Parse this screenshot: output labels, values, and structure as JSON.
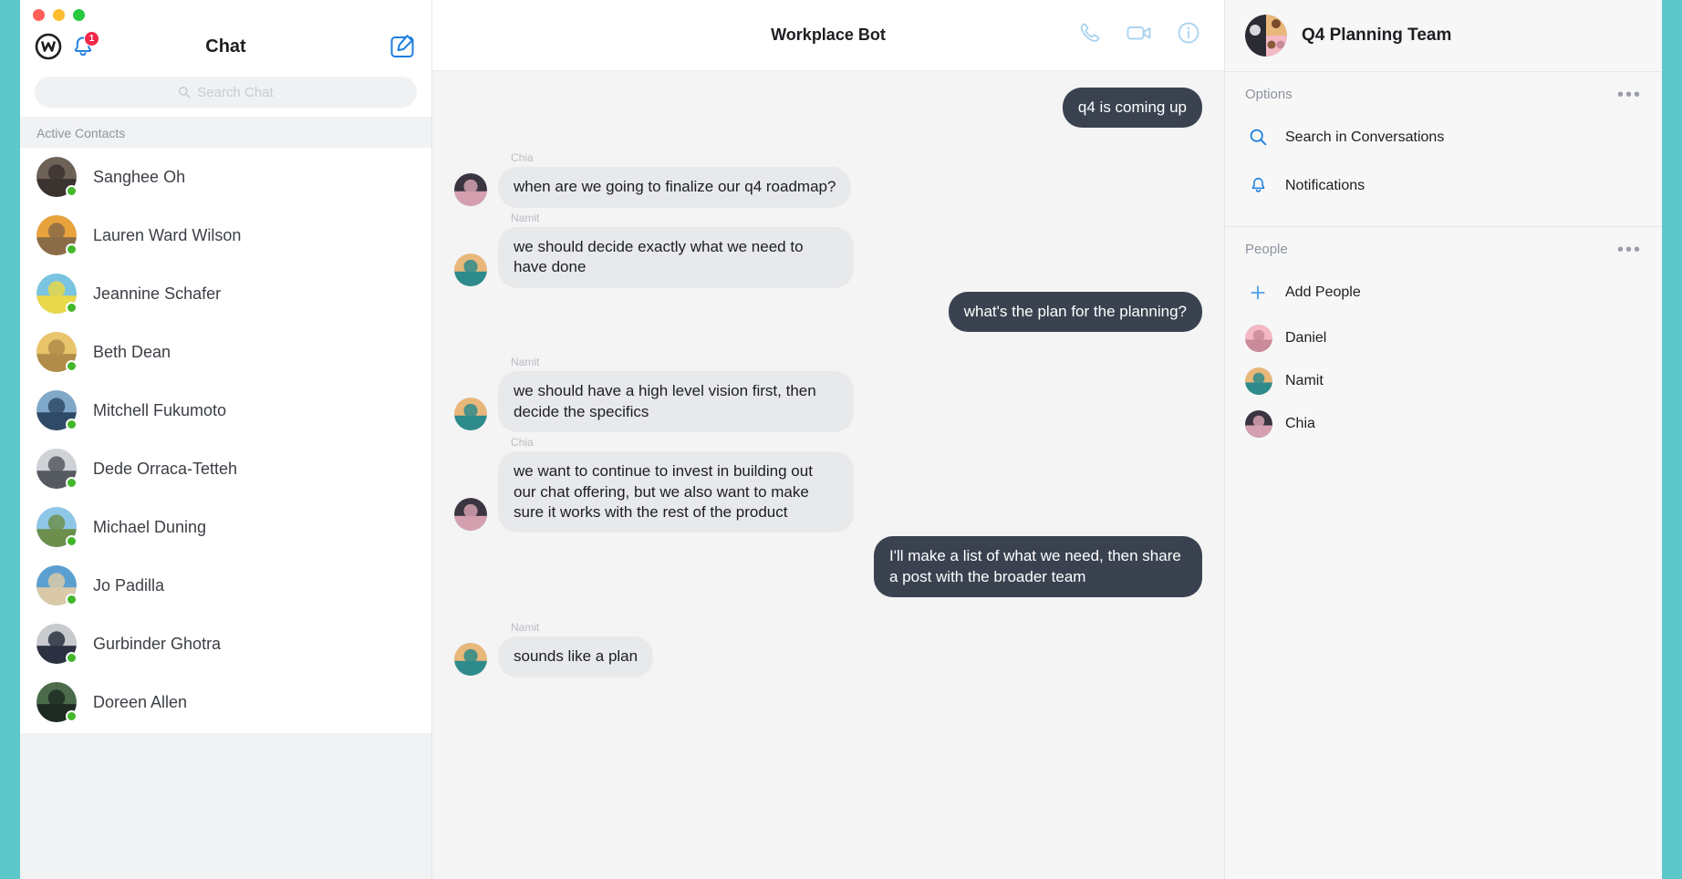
{
  "window": {
    "traffic_lights": [
      "close",
      "minimize",
      "maximize"
    ]
  },
  "sidebar": {
    "logo": "workplace-logo",
    "notifications_badge": "1",
    "title": "Chat",
    "compose_icon": "compose-icon",
    "search": {
      "placeholder": "Search Chat",
      "value": ""
    },
    "section_label": "Active Contacts",
    "contacts": [
      {
        "name": "Sanghee Oh",
        "status": "online",
        "avatar_colors": [
          "#6e6256",
          "#3b3330"
        ]
      },
      {
        "name": "Lauren Ward Wilson",
        "status": "online",
        "avatar_colors": [
          "#e8a33d",
          "#8a6c46"
        ]
      },
      {
        "name": "Jeannine Schafer",
        "status": "online",
        "avatar_colors": [
          "#79c4e0",
          "#e8d84a"
        ]
      },
      {
        "name": "Beth Dean",
        "status": "online",
        "avatar_colors": [
          "#e8c46a",
          "#b08c4a"
        ]
      },
      {
        "name": "Mitchell Fukumoto",
        "status": "online",
        "avatar_colors": [
          "#7fa8c9",
          "#2f4a66"
        ]
      },
      {
        "name": "Dede Orraca-Tetteh",
        "status": "online",
        "avatar_colors": [
          "#cfd2d6",
          "#555a60"
        ]
      },
      {
        "name": "Michael Duning",
        "status": "online",
        "avatar_colors": [
          "#8ec6e8",
          "#6c8f4e"
        ]
      },
      {
        "name": "Jo Padilla",
        "status": "online",
        "avatar_colors": [
          "#5b9fd1",
          "#d9c9a8"
        ]
      },
      {
        "name": "Gurbinder Ghotra",
        "status": "online",
        "avatar_colors": [
          "#c8cace",
          "#2b3140"
        ]
      },
      {
        "name": "Doreen Allen",
        "status": "online",
        "avatar_colors": [
          "#4b6b4a",
          "#1f2a22"
        ]
      }
    ]
  },
  "chat": {
    "title": "Workplace Bot",
    "header_icons": [
      "phone-icon",
      "video-icon",
      "info-icon"
    ],
    "messages": [
      {
        "direction": "out",
        "sender": "",
        "text": "q4 is coming up"
      },
      {
        "direction": "in",
        "sender": "Chia",
        "text": "when are we going to finalize our q4 roadmap?",
        "avatar_colors": [
          "#3a3540",
          "#d4a0b0"
        ]
      },
      {
        "direction": "in",
        "sender": "Namit",
        "text": "we should decide exactly what we need to have done",
        "avatar_colors": [
          "#e8b77a",
          "#2e8b8b"
        ]
      },
      {
        "direction": "out",
        "sender": "",
        "text": "what's the plan for the planning?"
      },
      {
        "direction": "in",
        "sender": "Namit",
        "text": "we should have a high level vision first, then decide the specifics",
        "avatar_colors": [
          "#e8b77a",
          "#2e8b8b"
        ]
      },
      {
        "direction": "in",
        "sender": "Chia",
        "text": "we want to continue to invest in building out our chat offering, but we also want to make sure it works with the rest of the product",
        "avatar_colors": [
          "#3a3540",
          "#d4a0b0"
        ]
      },
      {
        "direction": "out",
        "sender": "",
        "text": "I'll make a list of what we need, then share a post with the broader team"
      },
      {
        "direction": "in",
        "sender": "Namit",
        "text": "sounds like a plan",
        "avatar_colors": [
          "#e8b77a",
          "#2e8b8b"
        ]
      }
    ]
  },
  "right_panel": {
    "group_name": "Q4 Planning Team",
    "options": {
      "title": "Options",
      "menu_icon": "ellipsis-icon",
      "items": [
        {
          "label": "Search in Conversations",
          "icon": "search-icon"
        },
        {
          "label": "Notifications",
          "icon": "bell-icon"
        }
      ]
    },
    "people": {
      "title": "People",
      "menu_icon": "ellipsis-icon",
      "add_label": "Add People",
      "add_icon": "plus-icon",
      "members": [
        {
          "name": "Daniel",
          "avatar_colors": [
            "#f4b8c4",
            "#c98a9a"
          ]
        },
        {
          "name": "Namit",
          "avatar_colors": [
            "#e8b77a",
            "#2e8b8b"
          ]
        },
        {
          "name": "Chia",
          "avatar_colors": [
            "#3a3540",
            "#d4a0b0"
          ]
        }
      ]
    }
  },
  "colors": {
    "accent_teal": "#5cc8cc",
    "brand_blue": "#1d7fe0",
    "badge_red": "#f02849",
    "online_green": "#42b72a",
    "bubble_out": "#3a4250",
    "bubble_in": "#e8e9eb"
  }
}
